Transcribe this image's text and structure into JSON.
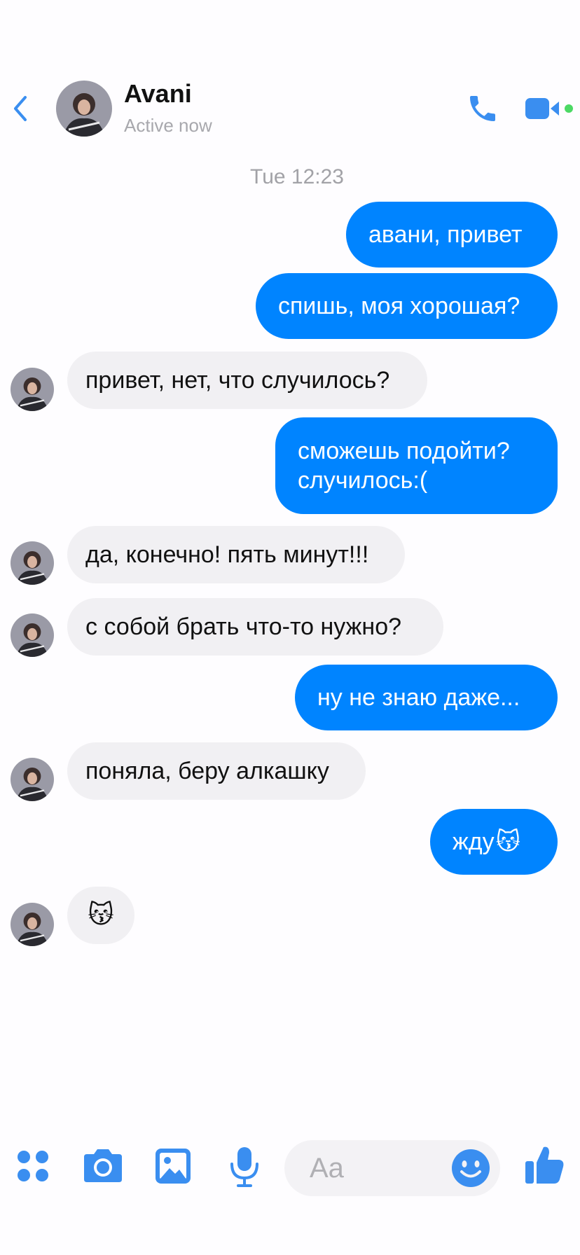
{
  "header": {
    "contact_name": "Avani",
    "status": "Active now"
  },
  "conversation": {
    "timestamp": "Tue 12:23",
    "messages": [
      {
        "direction": "outgoing",
        "text": "авани, привет"
      },
      {
        "direction": "outgoing",
        "text": "спишь, моя хорошая?"
      },
      {
        "direction": "incoming",
        "text": "привет, нет, что случилось?"
      },
      {
        "direction": "outgoing",
        "lines": [
          "сможешь подойти?",
          "случилось:("
        ]
      },
      {
        "direction": "incoming",
        "text": "да, конечно! пять минут!!!"
      },
      {
        "direction": "incoming",
        "text": "с собой брать что-то нужно?"
      },
      {
        "direction": "outgoing",
        "text": "ну не знаю даже..."
      },
      {
        "direction": "incoming",
        "text": "поняла, беру алкашку"
      },
      {
        "direction": "outgoing",
        "text": "жду",
        "emoji": "😽"
      },
      {
        "direction": "incoming",
        "emoji": "😽"
      }
    ]
  },
  "composer": {
    "placeholder": "Aa"
  },
  "colors": {
    "accent": "#0084ff",
    "incoming_bubble": "#f1f0f3",
    "active_dot": "#4cd964",
    "icon_blue": "#3a8ef0"
  },
  "icons": [
    "back-chevron-icon",
    "phone-icon",
    "video-camera-icon",
    "apps-grid-icon",
    "camera-icon",
    "photo-gallery-icon",
    "microphone-icon",
    "emoji-smile-icon",
    "thumbs-up-icon"
  ]
}
